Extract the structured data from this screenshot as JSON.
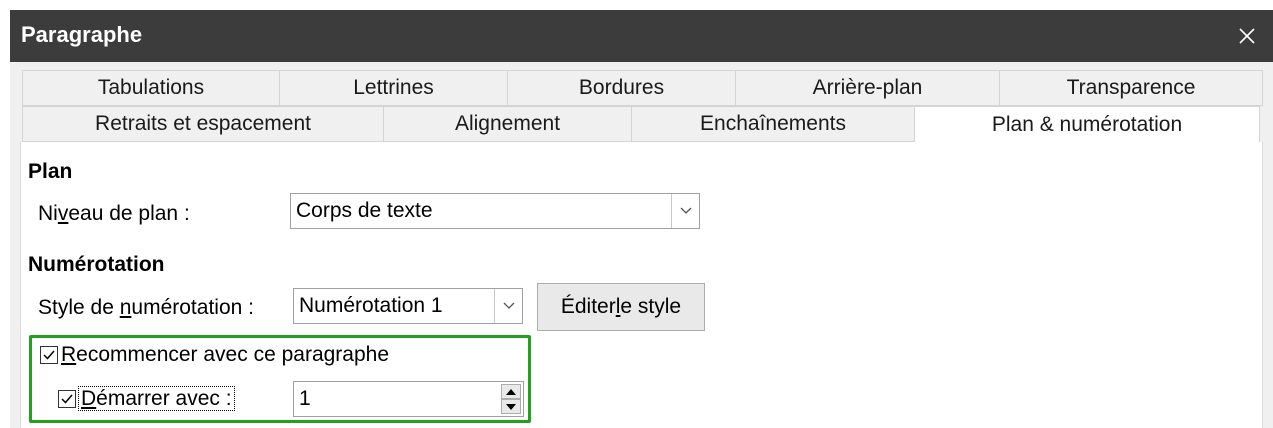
{
  "window": {
    "title": "Paragraphe"
  },
  "tabs": {
    "row1": [
      "Tabulations",
      "Lettrines",
      "Bordures",
      "Arrière-plan",
      "Transparence"
    ],
    "row2": [
      "Retraits et espacement",
      "Alignement",
      "Enchaînements",
      "Plan & numérotation"
    ]
  },
  "outline": {
    "heading": "Plan",
    "level_label_pre": "Ni",
    "level_label_mnemonic": "v",
    "level_label_post": "eau de plan :",
    "level_value": "Corps de texte"
  },
  "numbering": {
    "heading": "Numérotation",
    "style_label_pre": "Style de ",
    "style_label_mnemonic": "n",
    "style_label_post": "umérotation :",
    "style_value": "Numérotation 1",
    "edit_pre": "Éditer ",
    "edit_mnemonic": "l",
    "edit_post": "e style",
    "restart_mnemonic": "R",
    "restart_post": "ecommencer avec ce paragraphe",
    "restart_checked": true,
    "start_mnemonic": "D",
    "start_post": "émarrer avec :",
    "start_checked": true,
    "start_value": "1"
  },
  "colors": {
    "titlebar": "#3c3c3c",
    "highlight": "#22a020"
  }
}
